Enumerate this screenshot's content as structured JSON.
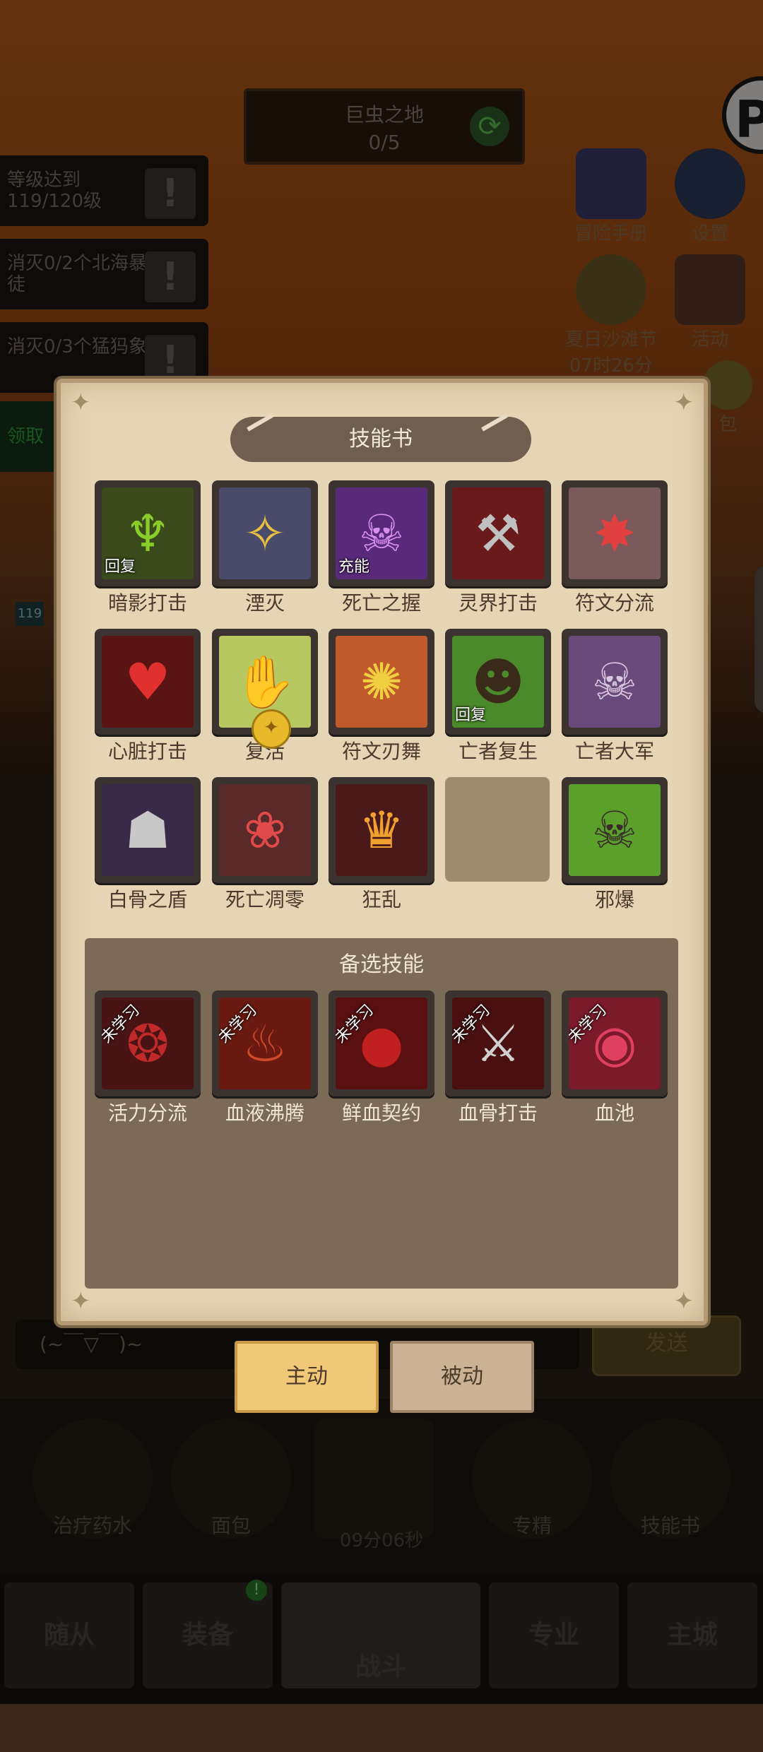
{
  "region": {
    "title": "巨虫之地",
    "progress": "0/5"
  },
  "quests": [
    {
      "text": "等级达到119/120级"
    },
    {
      "text": "消灭0/2个北海暴徒"
    },
    {
      "text": "消灭0/3个猛犸象"
    }
  ],
  "claim_label": "领取",
  "right_icons": {
    "handbook": "冒险手册",
    "settings": "设置",
    "event": "夏日沙滩节",
    "event_timer": "07时26分",
    "activity": "活动",
    "pack": "包"
  },
  "level_badge": "119",
  "edge_logo": "P",
  "modal": {
    "title": "技能书",
    "skills": [
      {
        "name": "暗影打击",
        "tag": "回复",
        "icon": "shadow-strike-icon"
      },
      {
        "name": "湮灭",
        "tag": "",
        "icon": "annihilate-icon"
      },
      {
        "name": "死亡之握",
        "tag": "充能",
        "icon": "death-grip-icon"
      },
      {
        "name": "灵界打击",
        "tag": "",
        "icon": "spirit-strike-icon"
      },
      {
        "name": "符文分流",
        "tag": "",
        "icon": "rune-split-icon"
      },
      {
        "name": "心脏打击",
        "tag": "",
        "icon": "heart-strike-icon"
      },
      {
        "name": "复活",
        "tag": "",
        "icon": "revive-icon"
      },
      {
        "name": "符文刃舞",
        "tag": "",
        "icon": "rune-blade-dance-icon"
      },
      {
        "name": "亡者复生",
        "tag": "回复",
        "icon": "raise-dead-icon"
      },
      {
        "name": "亡者大军",
        "tag": "",
        "icon": "army-of-dead-icon"
      },
      {
        "name": "白骨之盾",
        "tag": "",
        "icon": "bone-shield-icon"
      },
      {
        "name": "死亡凋零",
        "tag": "",
        "icon": "death-and-decay-icon"
      },
      {
        "name": "狂乱",
        "tag": "",
        "icon": "frenzy-icon"
      },
      {
        "name": "邪爆",
        "tag": "",
        "icon": "unholy-blast-icon"
      }
    ],
    "alt_title": "备选技能",
    "unlearned_label": "未学习",
    "alt_skills": [
      {
        "name": "活力分流",
        "icon": "vitality-split-icon"
      },
      {
        "name": "血液沸腾",
        "icon": "blood-boil-icon"
      },
      {
        "name": "鲜血契约",
        "icon": "blood-pact-icon"
      },
      {
        "name": "血骨打击",
        "icon": "blood-bone-strike-icon"
      },
      {
        "name": "血池",
        "icon": "blood-pool-icon"
      }
    ]
  },
  "mode_buttons": {
    "active": "主动",
    "passive": "被动"
  },
  "chat": {
    "placeholder": "(~￣▽￣)~",
    "send": "发送"
  },
  "dock": {
    "potion": "治疗药水",
    "bread": "面包",
    "chest_timer": "09分06秒",
    "specialize": "专精",
    "skillbook": "技能书"
  },
  "tabs": {
    "followers": "随从",
    "equipment": "装备",
    "battle": "战斗",
    "profession": "专业",
    "city": "主城"
  },
  "equipment_badge": "!",
  "colors": {
    "modal_bg": "#e6d5b4",
    "accent_active": "#f0c878",
    "alt_panel": "#7a6a56"
  }
}
